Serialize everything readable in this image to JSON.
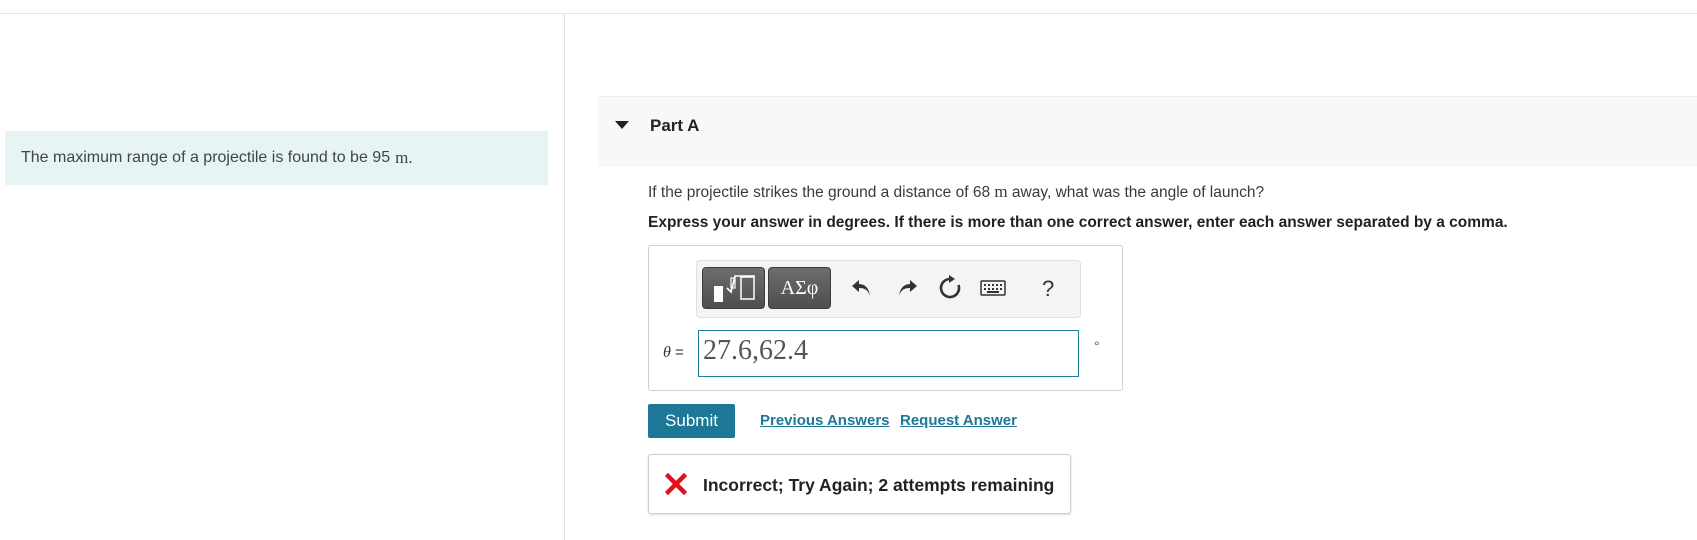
{
  "problem": {
    "text": "The maximum range of a projectile is found to be 95",
    "unit": "m."
  },
  "part": {
    "title": "Part A",
    "question_before": "If the projectile strikes the ground a distance of 68",
    "question_unit": "m",
    "question_after": "away, what was the angle of launch?",
    "instruction": "Express your answer in degrees. If there is more than one correct answer, enter each answer separated by a comma."
  },
  "toolbar": {
    "symbols_label": "ΑΣφ",
    "help_label": "?"
  },
  "answer": {
    "variable": "θ",
    "equals": "=",
    "value": "27.6,62.4",
    "unit": "°"
  },
  "actions": {
    "submit_label": "Submit",
    "previous_answers_label": "Previous Answers",
    "request_answer_label": "Request Answer"
  },
  "feedback": {
    "message": "Incorrect; Try Again; 2 attempts remaining"
  },
  "colors": {
    "accent": "#1c7896",
    "error": "#e0101e",
    "problem_bg": "#e6f4f4"
  }
}
